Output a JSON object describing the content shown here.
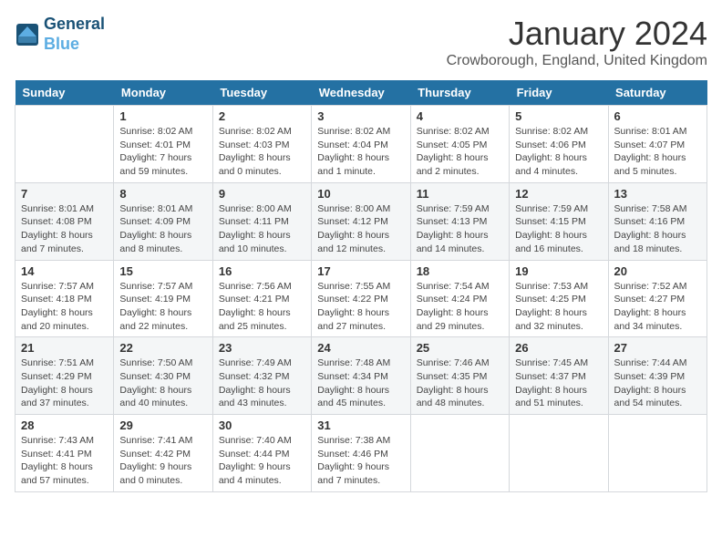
{
  "header": {
    "logo_line1": "General",
    "logo_line2": "Blue",
    "month": "January 2024",
    "location": "Crowborough, England, United Kingdom"
  },
  "days_of_week": [
    "Sunday",
    "Monday",
    "Tuesday",
    "Wednesday",
    "Thursday",
    "Friday",
    "Saturday"
  ],
  "weeks": [
    [
      {
        "num": "",
        "info": ""
      },
      {
        "num": "1",
        "info": "Sunrise: 8:02 AM\nSunset: 4:01 PM\nDaylight: 7 hours\nand 59 minutes."
      },
      {
        "num": "2",
        "info": "Sunrise: 8:02 AM\nSunset: 4:03 PM\nDaylight: 8 hours\nand 0 minutes."
      },
      {
        "num": "3",
        "info": "Sunrise: 8:02 AM\nSunset: 4:04 PM\nDaylight: 8 hours\nand 1 minute."
      },
      {
        "num": "4",
        "info": "Sunrise: 8:02 AM\nSunset: 4:05 PM\nDaylight: 8 hours\nand 2 minutes."
      },
      {
        "num": "5",
        "info": "Sunrise: 8:02 AM\nSunset: 4:06 PM\nDaylight: 8 hours\nand 4 minutes."
      },
      {
        "num": "6",
        "info": "Sunrise: 8:01 AM\nSunset: 4:07 PM\nDaylight: 8 hours\nand 5 minutes."
      }
    ],
    [
      {
        "num": "7",
        "info": "Sunrise: 8:01 AM\nSunset: 4:08 PM\nDaylight: 8 hours\nand 7 minutes."
      },
      {
        "num": "8",
        "info": "Sunrise: 8:01 AM\nSunset: 4:09 PM\nDaylight: 8 hours\nand 8 minutes."
      },
      {
        "num": "9",
        "info": "Sunrise: 8:00 AM\nSunset: 4:11 PM\nDaylight: 8 hours\nand 10 minutes."
      },
      {
        "num": "10",
        "info": "Sunrise: 8:00 AM\nSunset: 4:12 PM\nDaylight: 8 hours\nand 12 minutes."
      },
      {
        "num": "11",
        "info": "Sunrise: 7:59 AM\nSunset: 4:13 PM\nDaylight: 8 hours\nand 14 minutes."
      },
      {
        "num": "12",
        "info": "Sunrise: 7:59 AM\nSunset: 4:15 PM\nDaylight: 8 hours\nand 16 minutes."
      },
      {
        "num": "13",
        "info": "Sunrise: 7:58 AM\nSunset: 4:16 PM\nDaylight: 8 hours\nand 18 minutes."
      }
    ],
    [
      {
        "num": "14",
        "info": "Sunrise: 7:57 AM\nSunset: 4:18 PM\nDaylight: 8 hours\nand 20 minutes."
      },
      {
        "num": "15",
        "info": "Sunrise: 7:57 AM\nSunset: 4:19 PM\nDaylight: 8 hours\nand 22 minutes."
      },
      {
        "num": "16",
        "info": "Sunrise: 7:56 AM\nSunset: 4:21 PM\nDaylight: 8 hours\nand 25 minutes."
      },
      {
        "num": "17",
        "info": "Sunrise: 7:55 AM\nSunset: 4:22 PM\nDaylight: 8 hours\nand 27 minutes."
      },
      {
        "num": "18",
        "info": "Sunrise: 7:54 AM\nSunset: 4:24 PM\nDaylight: 8 hours\nand 29 minutes."
      },
      {
        "num": "19",
        "info": "Sunrise: 7:53 AM\nSunset: 4:25 PM\nDaylight: 8 hours\nand 32 minutes."
      },
      {
        "num": "20",
        "info": "Sunrise: 7:52 AM\nSunset: 4:27 PM\nDaylight: 8 hours\nand 34 minutes."
      }
    ],
    [
      {
        "num": "21",
        "info": "Sunrise: 7:51 AM\nSunset: 4:29 PM\nDaylight: 8 hours\nand 37 minutes."
      },
      {
        "num": "22",
        "info": "Sunrise: 7:50 AM\nSunset: 4:30 PM\nDaylight: 8 hours\nand 40 minutes."
      },
      {
        "num": "23",
        "info": "Sunrise: 7:49 AM\nSunset: 4:32 PM\nDaylight: 8 hours\nand 43 minutes."
      },
      {
        "num": "24",
        "info": "Sunrise: 7:48 AM\nSunset: 4:34 PM\nDaylight: 8 hours\nand 45 minutes."
      },
      {
        "num": "25",
        "info": "Sunrise: 7:46 AM\nSunset: 4:35 PM\nDaylight: 8 hours\nand 48 minutes."
      },
      {
        "num": "26",
        "info": "Sunrise: 7:45 AM\nSunset: 4:37 PM\nDaylight: 8 hours\nand 51 minutes."
      },
      {
        "num": "27",
        "info": "Sunrise: 7:44 AM\nSunset: 4:39 PM\nDaylight: 8 hours\nand 54 minutes."
      }
    ],
    [
      {
        "num": "28",
        "info": "Sunrise: 7:43 AM\nSunset: 4:41 PM\nDaylight: 8 hours\nand 57 minutes."
      },
      {
        "num": "29",
        "info": "Sunrise: 7:41 AM\nSunset: 4:42 PM\nDaylight: 9 hours\nand 0 minutes."
      },
      {
        "num": "30",
        "info": "Sunrise: 7:40 AM\nSunset: 4:44 PM\nDaylight: 9 hours\nand 4 minutes."
      },
      {
        "num": "31",
        "info": "Sunrise: 7:38 AM\nSunset: 4:46 PM\nDaylight: 9 hours\nand 7 minutes."
      },
      {
        "num": "",
        "info": ""
      },
      {
        "num": "",
        "info": ""
      },
      {
        "num": "",
        "info": ""
      }
    ]
  ]
}
